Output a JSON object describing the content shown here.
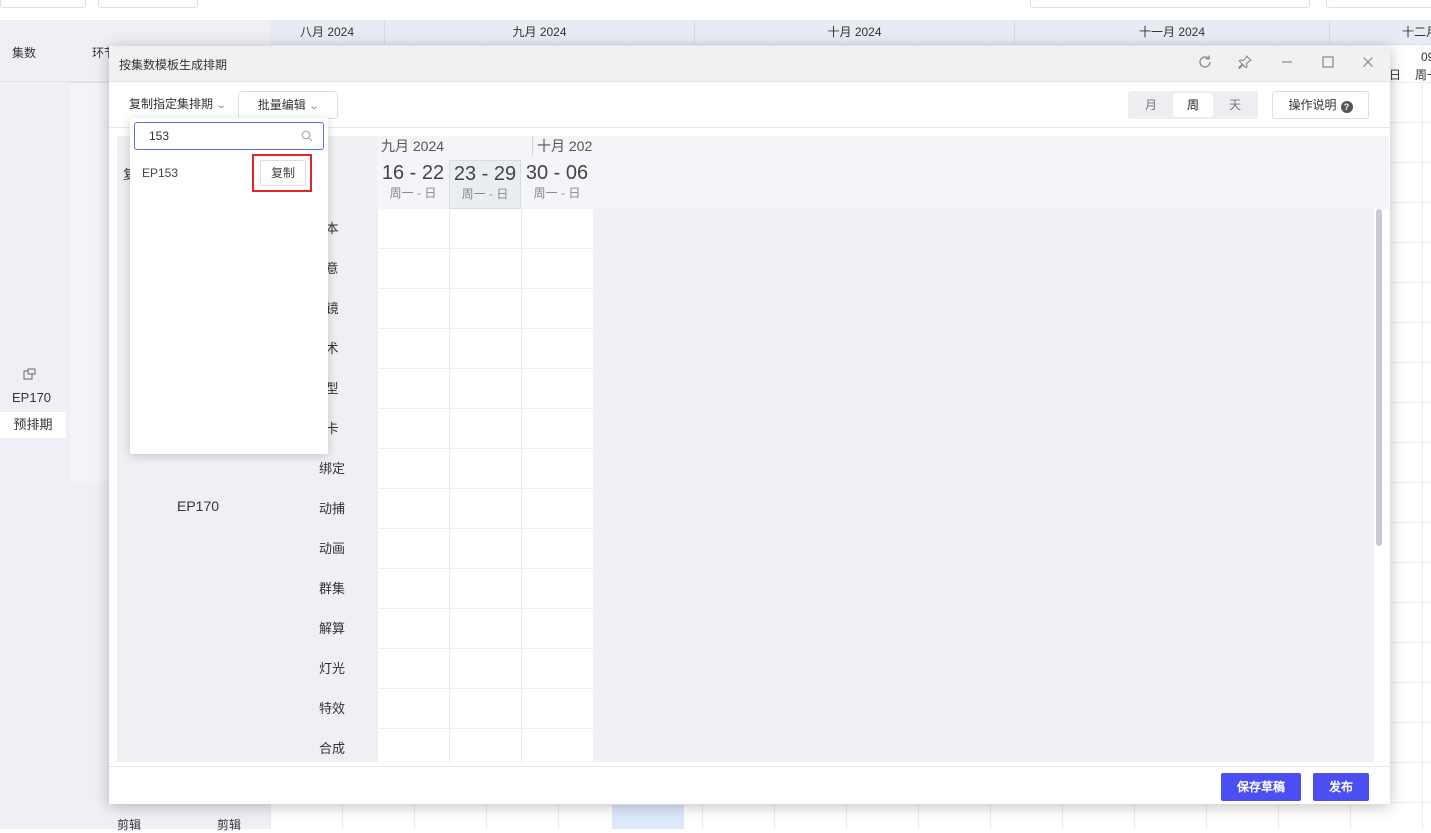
{
  "background": {
    "left_headers": {
      "episodes": "集数",
      "stage": "环节"
    },
    "months": [
      "八月 2024",
      "九月 2024",
      "十月 2024",
      "十一月 2024",
      "十二月"
    ],
    "right_edge_fragment": {
      "top": "09",
      "bottom": "周一"
    },
    "stray_day": "日",
    "episode": {
      "code": "EP170",
      "tag": "预排期"
    },
    "bottom_row": {
      "col1": "剪辑",
      "col2": "剪辑"
    }
  },
  "modal": {
    "title": "按集数模板生成排期",
    "toolbar": {
      "copy_dropdown": "复制指定集排期",
      "batch_edit": "批量编辑",
      "view_modes": [
        "月",
        "周",
        "天"
      ],
      "active_view": "周",
      "help": "操作说明"
    },
    "timeline": {
      "months": [
        "九月 2024",
        "十月 202"
      ],
      "weeks": [
        {
          "range": "16 - 22",
          "days": "周一 - 日"
        },
        {
          "range": "23 - 29",
          "days": "周一 - 日"
        },
        {
          "range": "30 - 06",
          "days": "周一 - 日"
        }
      ],
      "left_fragment": "复"
    },
    "episode": "EP170",
    "stages": [
      "本",
      "意",
      "镜",
      "术",
      "型",
      "卡",
      "绑定",
      "动捕",
      "动画",
      "群集",
      "解算",
      "灯光",
      "特效",
      "合成"
    ],
    "footer": {
      "save_draft": "保存草稿",
      "publish": "发布"
    }
  },
  "dropdown": {
    "search_value": "153",
    "items": [
      {
        "label": "EP153",
        "action": "复制"
      }
    ]
  }
}
